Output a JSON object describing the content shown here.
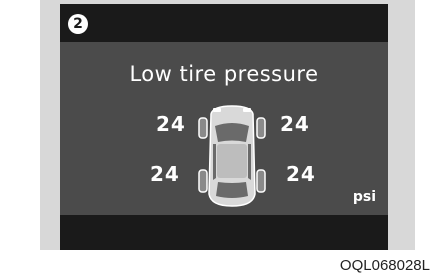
{
  "display": {
    "step_badge": "2",
    "title": "Low tire pressure",
    "tires": {
      "front_left": "24",
      "front_right": "24",
      "rear_left": "24",
      "rear_right": "24"
    },
    "unit": "psi"
  },
  "caption": "OQL068028L",
  "colors": {
    "bezel": "#1a1a1a",
    "screen": "#4b4b4b",
    "frame": "#d8d8d8",
    "text": "#ffffff"
  },
  "icons": [
    "car-top-view-icon"
  ]
}
